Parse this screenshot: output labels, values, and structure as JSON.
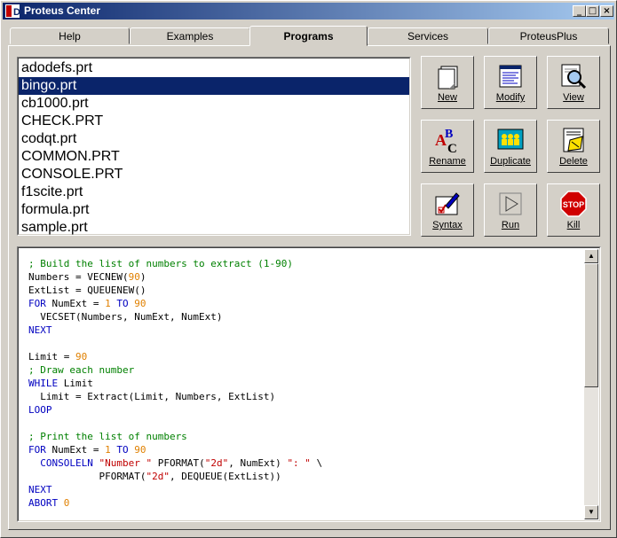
{
  "window": {
    "title": "Proteus Center"
  },
  "tabs": [
    "Help",
    "Examples",
    "Programs",
    "Services",
    "ProteusPlus"
  ],
  "active_tab": "Programs",
  "files": [
    "adodefs.prt",
    "bingo.prt",
    "cb1000.prt",
    "CHECK.PRT",
    "codqt.prt",
    "COMMON.PRT",
    "CONSOLE.PRT",
    "f1scite.prt",
    "formula.prt",
    "sample.prt"
  ],
  "selected_file": "bingo.prt",
  "buttons": {
    "new": "New",
    "modify": "Modify",
    "view": "View",
    "rename": "Rename",
    "duplicate": "Duplicate",
    "delete": "Delete",
    "syntax": "Syntax",
    "run": "Run",
    "kill": "Kill"
  },
  "code": {
    "l1": "; Build the list of numbers to extract (1-90)",
    "l2a": "Numbers = VECNEW(",
    "l2b": "90",
    "l2c": ")",
    "l3": "ExtList = QUEUENEW()",
    "l4a": "FOR",
    "l4b": " NumExt = ",
    "l4c": "1",
    "l4d": " TO ",
    "l4e": "90",
    "l5": "  VECSET(Numbers, NumExt, NumExt)",
    "l6": "NEXT",
    "l8a": "Limit = ",
    "l8b": "90",
    "l9": "; Draw each number",
    "l10a": "WHILE",
    "l10b": " Limit",
    "l11": "  Limit = Extract(Limit, Numbers, ExtList)",
    "l12": "LOOP",
    "l14": "; Print the list of numbers",
    "l15a": "FOR",
    "l15b": " NumExt = ",
    "l15c": "1",
    "l15d": " TO ",
    "l15e": "90",
    "l16a": "  CONSOLELN ",
    "l16b": "\"Number \"",
    "l16c": " PFORMAT(",
    "l16d": "\"2d\"",
    "l16e": ", NumExt) ",
    "l16f": "\": \"",
    "l16g": " \\",
    "l17a": "            PFORMAT(",
    "l17b": "\"2d\"",
    "l17c": ", DEQUEUE(ExtList))",
    "l18": "NEXT",
    "l19a": "ABORT ",
    "l19b": "0"
  }
}
